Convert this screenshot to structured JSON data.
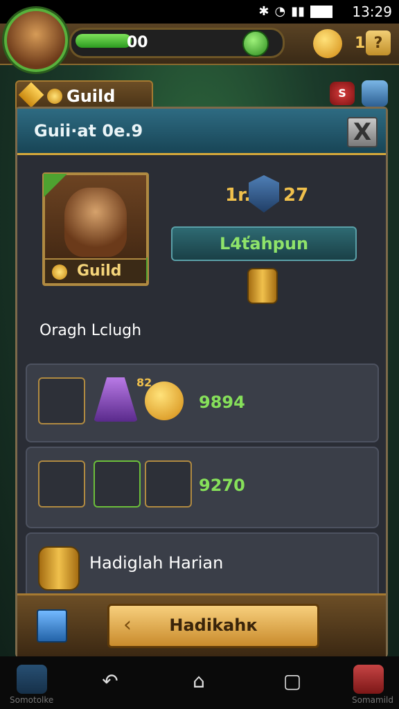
{
  "status": {
    "time": "13:29"
  },
  "topbar": {
    "xp_progress": 0.28,
    "xp_text": "00",
    "coin_count": "1",
    "help_label": "?"
  },
  "guild_tab": {
    "label": "Guild"
  },
  "side_icons": {
    "red_label": "S"
  },
  "panel": {
    "title": "Guii·at 0e.9",
    "close_label": "X",
    "hero_card_label": "Guild",
    "rank_prefix": "1r.",
    "rank_number": "27",
    "champion_button": "L4ťahpun",
    "player_name": "Oragh Lclugh",
    "row1_value": "9894",
    "row1_sub_value": "82",
    "row2_value": "9270",
    "row3_text": "Hadiglah Harian",
    "main_button": "Hadikahк"
  },
  "navbar": {
    "left_label": "Somotolke",
    "right_label": "Somamild"
  },
  "colors": {
    "accent_green": "#86e05a",
    "gold": "#f0c04c",
    "panel_bg": "#2a2d35",
    "header_teal": "#2e6b82"
  }
}
